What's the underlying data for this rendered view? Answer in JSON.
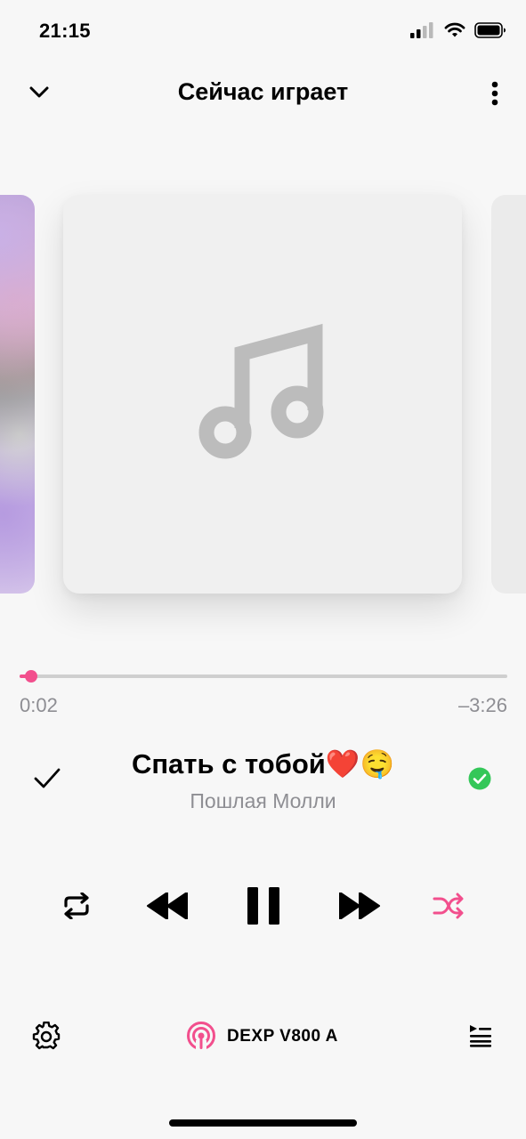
{
  "status_bar": {
    "time": "21:15"
  },
  "header": {
    "title": "Сейчас играет"
  },
  "player": {
    "elapsed": "0:02",
    "remaining": "–3:26",
    "progress_fraction": 0.024,
    "title": "Спать с тобой❤️🤤",
    "artist": "Пошлая Молли"
  },
  "output_device": {
    "name": "DEXP V800 A"
  },
  "colors": {
    "accent": "#f24f8d",
    "downloaded": "#34c759",
    "shuffle": "#f24f8d"
  },
  "icons": {
    "collapse": "chevron-down-icon",
    "more": "more-vertical-icon",
    "add": "checkmark-icon",
    "downloaded": "downloaded-check-icon",
    "repeat": "repeat-icon",
    "previous": "rewind-icon",
    "play_pause": "pause-icon",
    "next": "fast-forward-icon",
    "shuffle": "shuffle-icon",
    "settings": "gear-icon",
    "airplay": "broadcast-icon",
    "queue": "queue-icon",
    "artwork_placeholder": "music-note-icon"
  }
}
